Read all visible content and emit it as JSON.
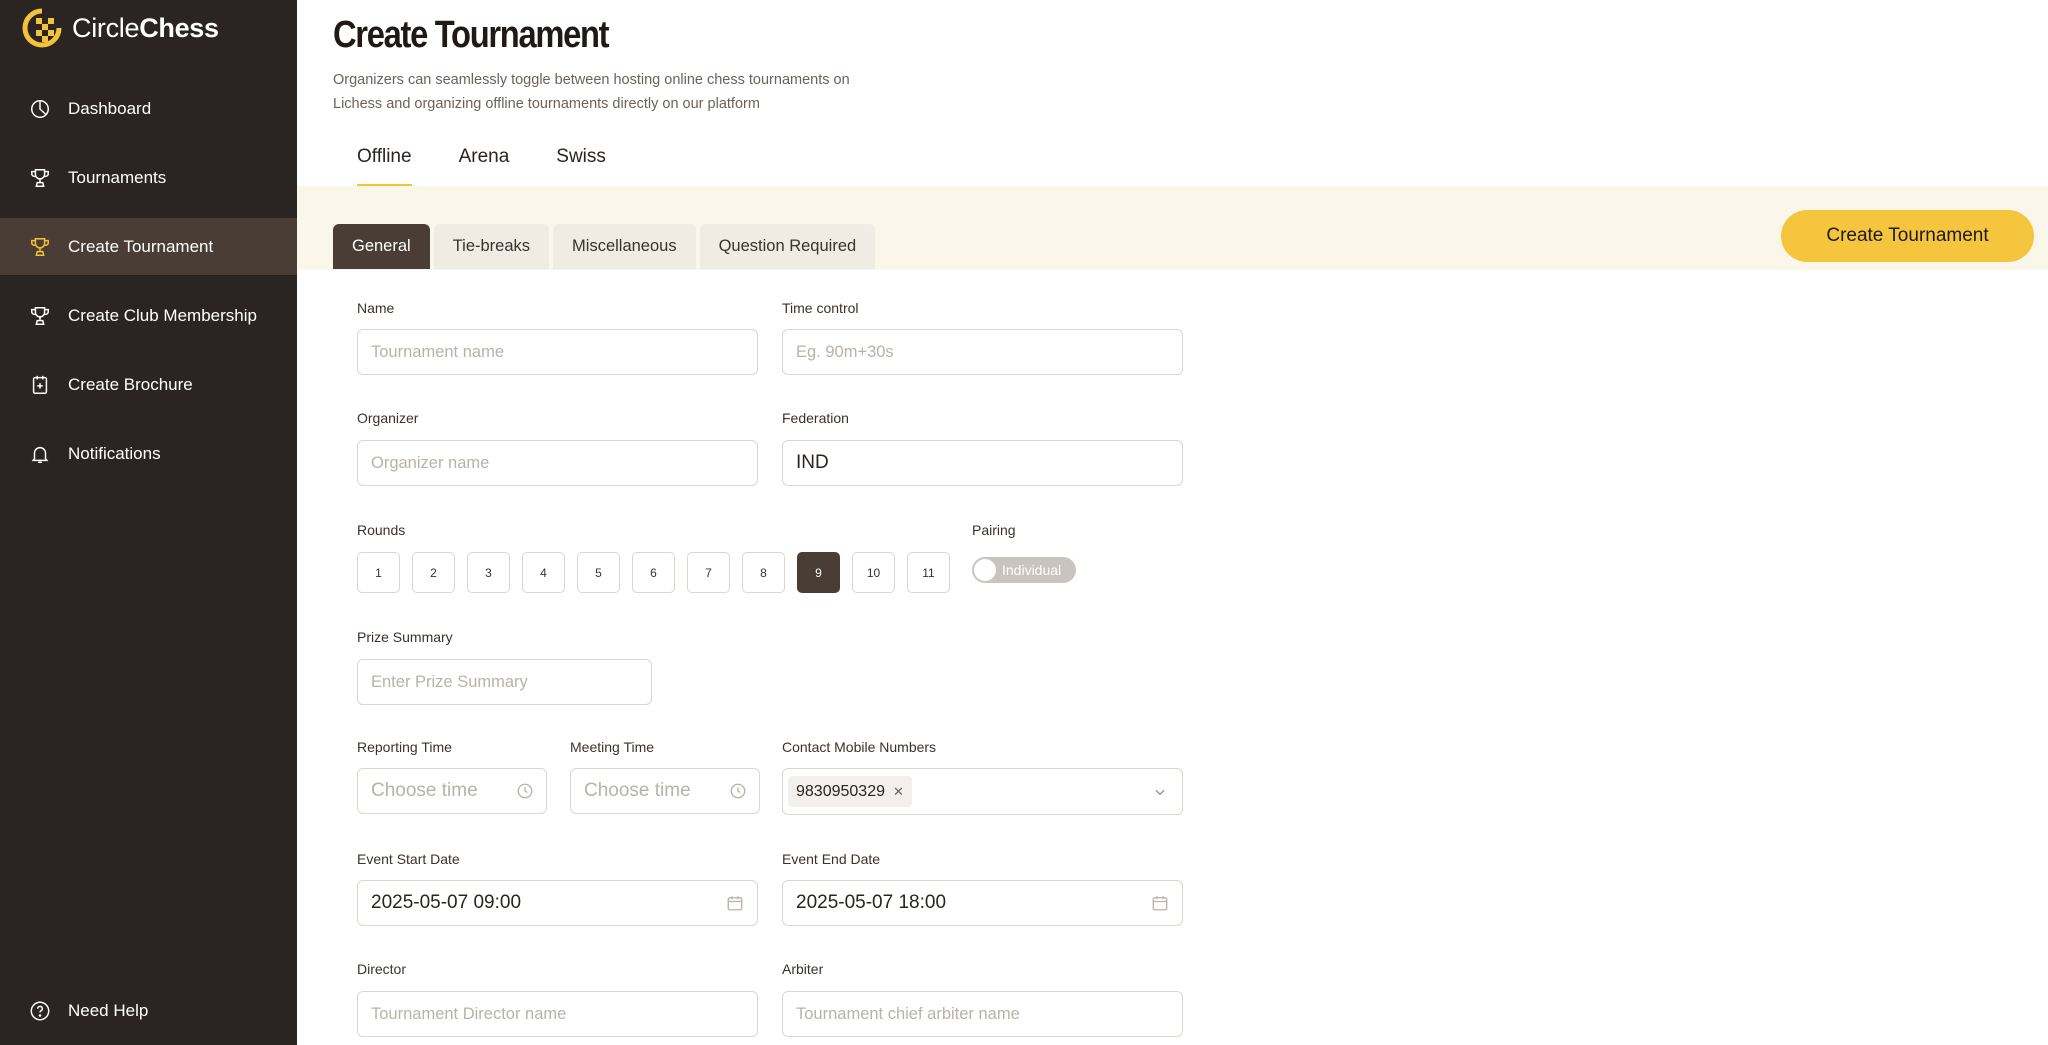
{
  "app": {
    "logo_prefix": "Circle",
    "logo_bold": "Chess"
  },
  "sidebar": {
    "items": [
      {
        "label": "Dashboard",
        "icon": "pie-chart-icon"
      },
      {
        "label": "Tournaments",
        "icon": "trophy-icon"
      },
      {
        "label": "Create Tournament",
        "icon": "trophy-icon",
        "active": true
      },
      {
        "label": "Create Club Membership",
        "icon": "trophy-icon"
      },
      {
        "label": "Create Brochure",
        "icon": "brochure-add-icon"
      },
      {
        "label": "Notifications",
        "icon": "bell-icon"
      }
    ],
    "help_label": "Need Help"
  },
  "header": {
    "title": "Create Tournament",
    "description": "Organizers can seamlessly toggle between hosting online chess tournaments on Lichess and organizing offline tournaments directly on our platform"
  },
  "mode_tabs": [
    "Offline",
    "Arena",
    "Swiss"
  ],
  "form_tabs": [
    "General",
    "Tie-breaks",
    "Miscellaneous",
    "Question Required"
  ],
  "create_button": "Create Tournament",
  "form": {
    "name": {
      "label": "Name",
      "placeholder": "Tournament name"
    },
    "time_control": {
      "label": "Time control",
      "placeholder": "Eg. 90m+30s"
    },
    "organizer": {
      "label": "Organizer",
      "placeholder": "Organizer name"
    },
    "federation": {
      "label": "Federation",
      "value": "IND"
    },
    "rounds": {
      "label": "Rounds",
      "options": [
        "1",
        "2",
        "3",
        "4",
        "5",
        "6",
        "7",
        "8",
        "9",
        "10",
        "11"
      ],
      "selected": "9"
    },
    "pairing": {
      "label": "Pairing",
      "value": "Individual"
    },
    "prize_summary": {
      "label": "Prize Summary",
      "placeholder": "Enter Prize Summary"
    },
    "reporting_time": {
      "label": "Reporting Time",
      "placeholder": "Choose time"
    },
    "meeting_time": {
      "label": "Meeting Time",
      "placeholder": "Choose time"
    },
    "contact_numbers": {
      "label": "Contact Mobile Numbers",
      "values": [
        "9830950329"
      ]
    },
    "event_start": {
      "label": "Event Start Date",
      "value": "2025-05-07 09:00"
    },
    "event_end": {
      "label": "Event End Date",
      "value": "2025-05-07 18:00"
    },
    "director": {
      "label": "Director",
      "placeholder": "Tournament Director name"
    },
    "arbiter": {
      "label": "Arbiter",
      "placeholder": "Tournament chief arbiter name"
    }
  },
  "colors": {
    "sidebar_bg": "#2a2522",
    "active_bg": "#4a3d35",
    "accent": "#f5c53e",
    "band_bg": "#faf6ea"
  }
}
